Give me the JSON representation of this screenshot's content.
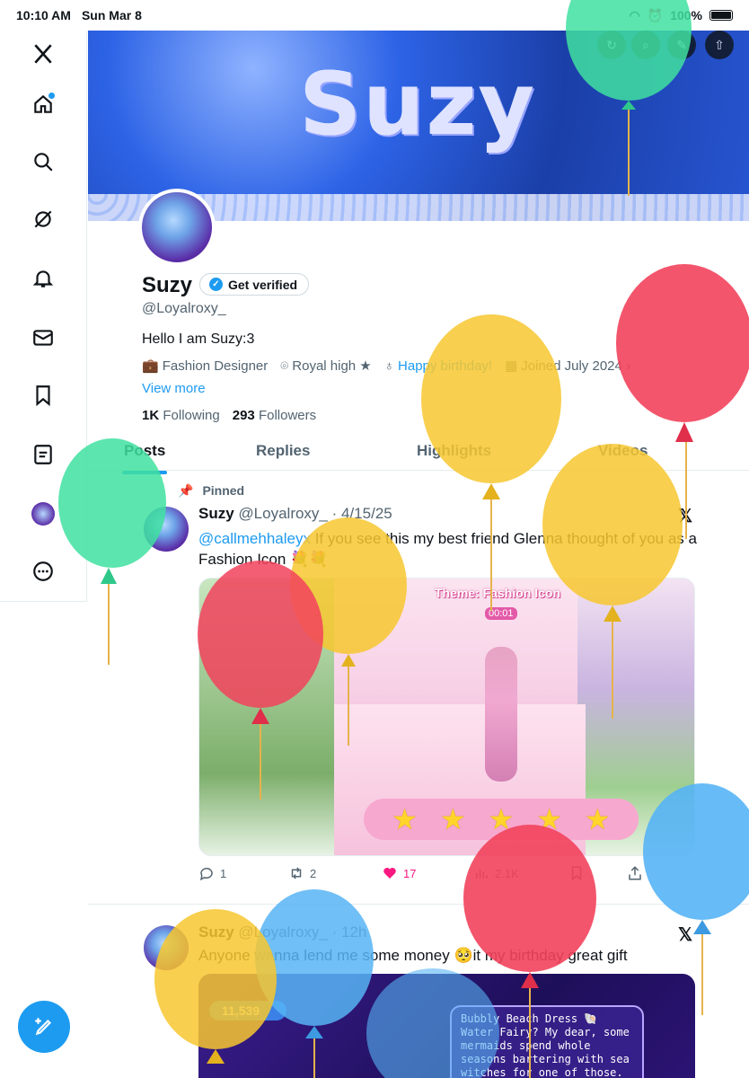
{
  "status_bar": {
    "time": "10:10 AM",
    "date": "Sun Mar 8",
    "battery": "100%"
  },
  "profile": {
    "banner_text": "Suzy",
    "name": "Suzy",
    "get_verified_label": "Get verified",
    "handle": "@Loyalroxy_",
    "bio": "Hello I am Suzy:3",
    "profession": "Fashion Designer",
    "location": "Royal high ★",
    "birthday": "Happy birthday!",
    "joined": "Joined July 2024",
    "view_more": "View more",
    "following_count": "1K",
    "following_label": "Following",
    "followers_count": "293",
    "followers_label": "Followers"
  },
  "tabs": [
    "Posts",
    "Replies",
    "Highlights",
    "Videos"
  ],
  "tweets": [
    {
      "pinned_label": "Pinned",
      "name": "Suzy",
      "handle": "@Loyalroxy_",
      "time": "· 4/15/25",
      "mention": "@callmehhaleyx",
      "text": " If you see this my best friend Glenna thought of you as a Fashion Icon 💐💐",
      "media": {
        "theme_label": "Theme: Fashion Icon",
        "timer": "00:01"
      },
      "replies": "1",
      "reposts": "2",
      "likes": "17",
      "views": "2.1K"
    },
    {
      "name": "Suzy",
      "handle": "@Loyalroxy_",
      "time": "· 12h",
      "text": "Anyone wanna lend me some money 🥺it my birthday great gift",
      "media": {
        "count": "11,539",
        "dialog": "Bubbly Beach Dress 🐚 Water Fairy? My dear, some mermaids spend whole seasons bartering with sea witches for one of those. You, however, need only"
      }
    }
  ],
  "balloon_colors": {
    "green": "#3fe0a0",
    "yellow": "#f7c72f",
    "red": "#f2425c",
    "blue": "#57b4f5"
  }
}
